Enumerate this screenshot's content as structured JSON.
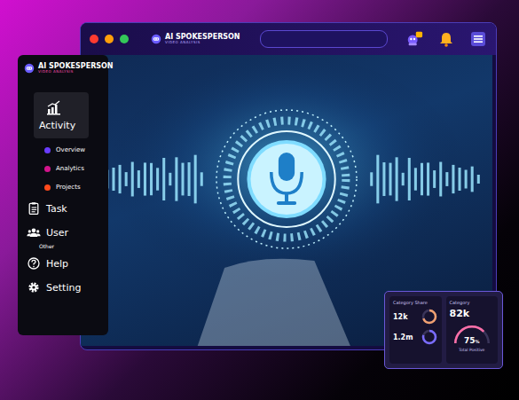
{
  "browser": {
    "logo": "AI SPOKESPERSON",
    "logo_tagline": "VIDEO ANALYSIS",
    "traffic_lights": [
      {
        "color": "#ff3b30"
      },
      {
        "color": "#ff9f0a"
      },
      {
        "color": "#34c759"
      }
    ]
  },
  "sidebar": {
    "logo": "AI SPOKESPERSON",
    "logo_tagline": "VIDEO ANALYSIS",
    "items": [
      {
        "label": "Activity",
        "kind": "main",
        "selected": true
      },
      {
        "label": "Overview",
        "kind": "sub",
        "selected": false,
        "color": "#6a3cff"
      },
      {
        "label": "Analytics",
        "kind": "sub",
        "selected": false,
        "color": "#d4148c"
      },
      {
        "label": "Projects",
        "kind": "sub",
        "selected": false,
        "color": "#ff4a1c"
      },
      {
        "label": "Task",
        "kind": "main",
        "selected": false
      },
      {
        "label": "User",
        "kind": "main",
        "selected": false
      },
      {
        "label": "Other",
        "kind": "section",
        "selected": false
      },
      {
        "label": "Help",
        "kind": "main",
        "selected": false
      },
      {
        "label": "Setting",
        "kind": "main",
        "selected": false
      }
    ]
  },
  "stats": {
    "share": {
      "title": "Category Share",
      "rings": [
        {
          "value": "12k",
          "level": 0.7,
          "color": "#f0a070"
        },
        {
          "value": "1.2m",
          "level": 0.8,
          "color": "#7a6cff"
        }
      ]
    },
    "gauge": {
      "title": "Category",
      "value": "82k",
      "level": 0.75,
      "reading": "75",
      "unit": "%",
      "caption": "Total Positive"
    }
  }
}
